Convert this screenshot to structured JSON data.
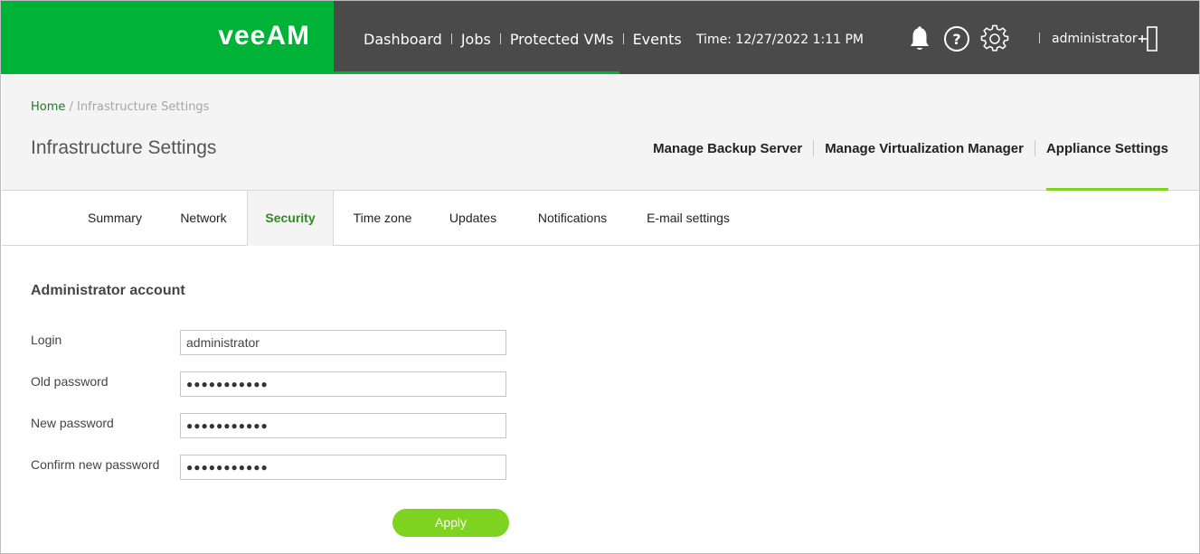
{
  "brand": {
    "logo_text": "veeAM",
    "color_green": "#00b336",
    "color_apply": "#7ed321",
    "color_topbar": "#4a4a4a"
  },
  "topnav": {
    "items": [
      "Dashboard",
      "Jobs",
      "Protected VMs",
      "Events"
    ],
    "time": "Time: 12/27/2022 1:11 PM",
    "icons": [
      "bell-icon",
      "help-icon",
      "gear-icon",
      "logout-icon"
    ],
    "user": "administrator"
  },
  "breadcrumb": {
    "home": "Home",
    "separator": " / ",
    "current": "Infrastructure Settings"
  },
  "page": {
    "title": "Infrastructure Settings"
  },
  "subnav": {
    "items": [
      "Manage Backup Server",
      "Manage Virtualization Manager",
      "Appliance Settings"
    ],
    "active": "Appliance Settings"
  },
  "tabs": {
    "items": [
      "Summary",
      "Network",
      "Security",
      "Time zone",
      "Updates",
      "Notifications",
      "E-mail settings"
    ],
    "active": "Security"
  },
  "form": {
    "section_title": "Administrator account",
    "login_label": "Login",
    "login_value": "administrator",
    "old_password_label": "Old password",
    "old_password_value": "●●●●●●●●●●●",
    "new_password_label": "New password",
    "new_password_value": "●●●●●●●●●●●",
    "confirm_password_label": "Confirm new password",
    "confirm_password_value": "●●●●●●●●●●●",
    "apply_label": "Apply"
  }
}
